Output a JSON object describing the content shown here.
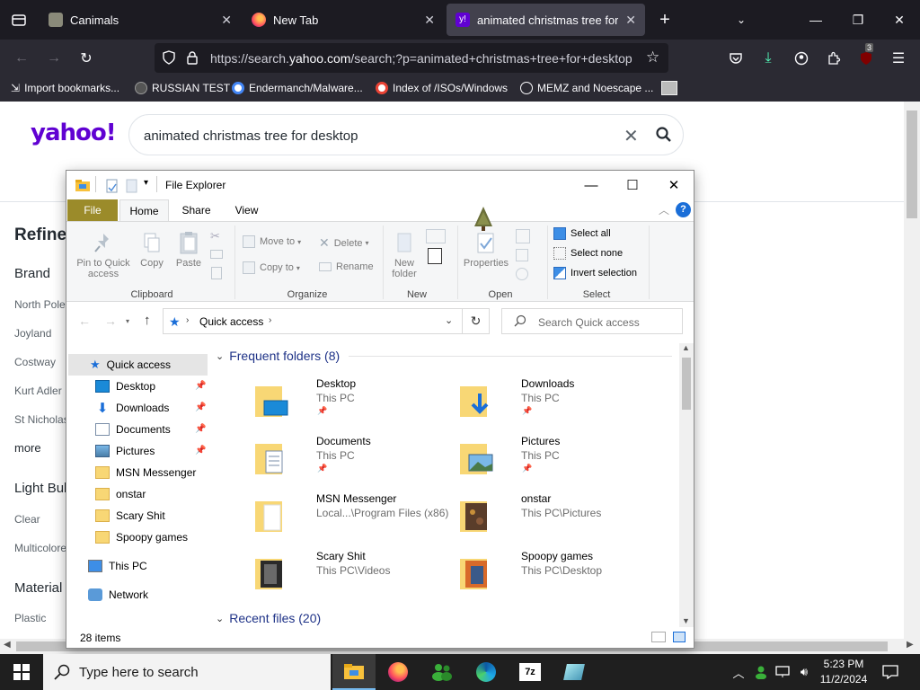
{
  "browser": {
    "tabs": [
      {
        "label": "Canimals",
        "active": false
      },
      {
        "label": "New Tab",
        "active": false
      },
      {
        "label": "animated christmas tree for desk",
        "active": true
      }
    ],
    "url_prefix": "https://search.",
    "url_domain": "yahoo.com",
    "url_rest": "/search;?p=animated+christmas+tree+for+desktop",
    "downloads_badge": "3",
    "bookmarks": [
      "Import bookmarks...",
      "RUSSIAN TEST",
      "Endermanch/Malware...",
      "Index of /ISOs/Windows",
      "MEMZ and Noescape ..."
    ]
  },
  "yahoo": {
    "logo": "yahoo!",
    "query": "animated christmas tree for desktop",
    "refine_title": "Refine",
    "brand_title": "Brand",
    "brands": [
      "North Pole",
      "Joyland",
      "Costway",
      "Kurt Adler",
      "St Nicholas"
    ],
    "more": "more",
    "light_bulb_title": "Light Bulb",
    "light_bulbs": [
      "Clear",
      "Multicolored"
    ],
    "material_title": "Material",
    "materials": [
      "Plastic"
    ]
  },
  "explorer": {
    "title": "File Explorer",
    "tabs": [
      "File",
      "Home",
      "Share",
      "View"
    ],
    "clipboard": {
      "pin": "Pin to Quick access",
      "copy": "Copy",
      "paste": "Paste",
      "label": "Clipboard"
    },
    "organize": {
      "move_to": "Move to",
      "copy_to": "Copy to",
      "delete": "Delete",
      "rename": "Rename",
      "label": "Organize"
    },
    "new": {
      "new_folder": "New folder",
      "label": "New"
    },
    "open": {
      "properties": "Properties",
      "label": "Open"
    },
    "select": {
      "select_all": "Select all",
      "select_none": "Select none",
      "invert": "Invert selection",
      "label": "Select"
    },
    "address": "Quick access",
    "search_placeholder": "Search Quick access",
    "nav": [
      "Quick access",
      "Desktop",
      "Downloads",
      "Documents",
      "Pictures",
      "MSN Messenger",
      "onstar",
      "Scary Shit",
      "Spoopy games",
      "This PC",
      "Network"
    ],
    "frequent_header": "Frequent folders (8)",
    "folders": [
      {
        "name": "Desktop",
        "loc": "This PC",
        "pinned": true
      },
      {
        "name": "Downloads",
        "loc": "This PC",
        "pinned": true
      },
      {
        "name": "Documents",
        "loc": "This PC",
        "pinned": true
      },
      {
        "name": "Pictures",
        "loc": "This PC",
        "pinned": true
      },
      {
        "name": "MSN Messenger",
        "loc": "Local...\\Program Files (x86)",
        "pinned": false
      },
      {
        "name": "onstar",
        "loc": "This PC\\Pictures",
        "pinned": false
      },
      {
        "name": "Scary Shit",
        "loc": "This PC\\Videos",
        "pinned": false
      },
      {
        "name": "Spoopy games",
        "loc": "This PC\\Desktop",
        "pinned": false
      }
    ],
    "recent_header": "Recent files (20)",
    "status": "28 items"
  },
  "taskbar": {
    "search_placeholder": "Type here to search",
    "time": "5:23 PM",
    "date": "11/2/2024"
  }
}
